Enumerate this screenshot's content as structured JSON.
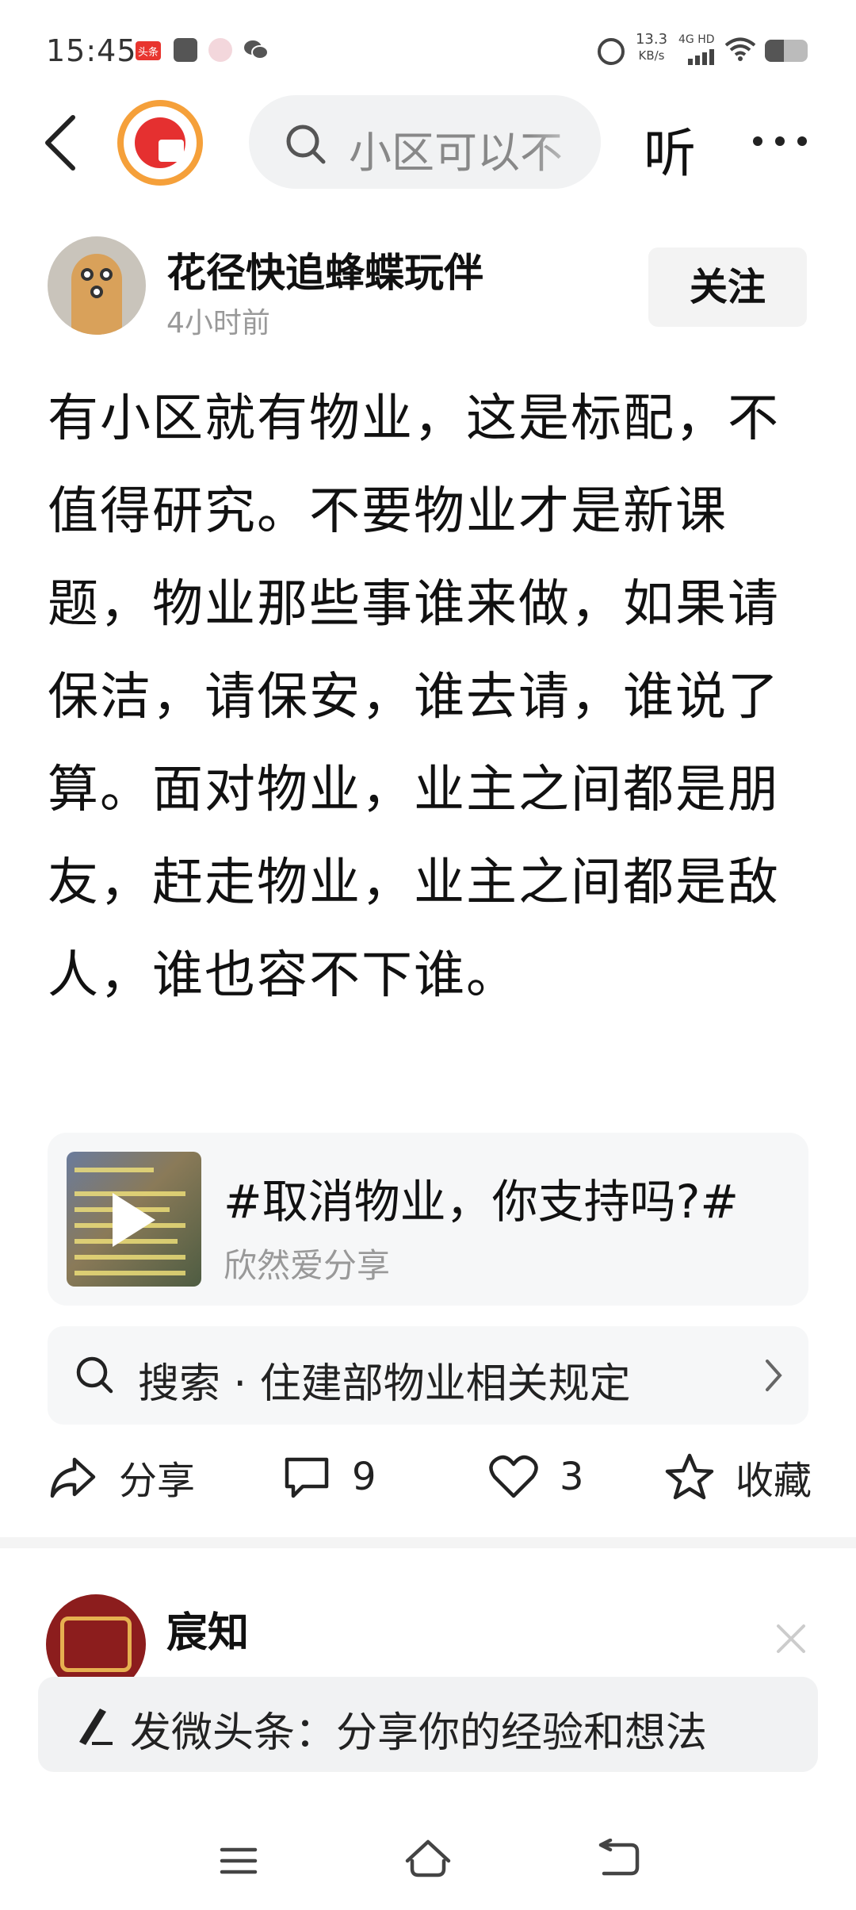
{
  "status_bar": {
    "time": "15:45",
    "news_badge": "头条",
    "net_speed_value": "13.3",
    "net_speed_unit": "KB/s",
    "network": "4G HD",
    "battery_level": 0.45
  },
  "top_bar": {
    "search_placeholder": "小区可以不",
    "listen_label": "听"
  },
  "author": {
    "name": "花径快追蜂蝶玩伴",
    "time": "4小时前",
    "follow_label": "关注"
  },
  "post": {
    "text": "有小区就有物业，这是标配，不值得研究。不要物业才是新课题，物业那些事谁来做，如果请保洁，请保安，谁去请，谁说了算。面对物业，业主之间都是朋友，赶走物业，业主之间都是敌人，谁也容不下谁。"
  },
  "topic_card": {
    "title": "#取消物业，你支持吗?#",
    "source": "欣然爱分享"
  },
  "search_suggestion": {
    "text": "搜索 · 住建部物业相关规定"
  },
  "actions": {
    "share_label": "分享",
    "comment_count": "9",
    "like_count": "3",
    "favorite_label": "收藏"
  },
  "next_post": {
    "author_name": "宸知"
  },
  "compose": {
    "placeholder": "发微头条：分享你的经验和想法"
  }
}
